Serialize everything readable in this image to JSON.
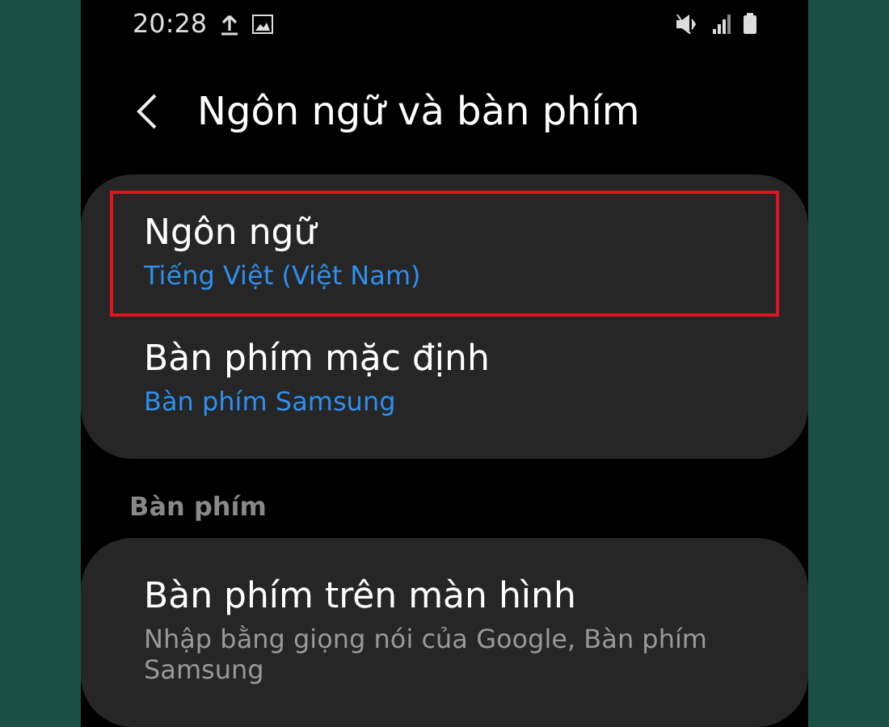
{
  "status_bar": {
    "time": "20:28"
  },
  "header": {
    "title": "Ngôn ngữ và bàn phím"
  },
  "groups": [
    {
      "items": [
        {
          "title": "Ngôn ngữ",
          "summary": "Tiếng Việt (Việt Nam)",
          "kind": "value",
          "highlighted": true
        },
        {
          "title": "Bàn phím mặc định",
          "summary": "Bàn phím Samsung",
          "kind": "value",
          "highlighted": false
        }
      ]
    },
    {
      "heading": "Bàn phím",
      "items": [
        {
          "title": "Bàn phím trên màn hình",
          "summary": "Nhập bằng giọng nói của Google, Bàn phím Samsung",
          "kind": "description",
          "highlighted": false
        }
      ]
    }
  ]
}
